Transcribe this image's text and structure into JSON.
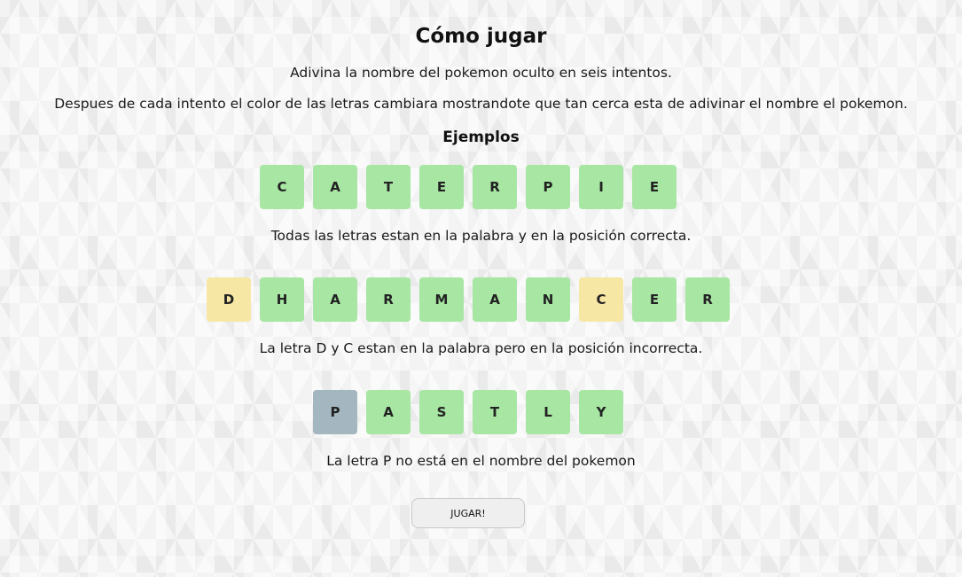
{
  "title": "Cómo jugar",
  "instructions": [
    "Adivina la nombre del pokemon oculto en seis intentos.",
    "Despues de cada intento el color de las letras cambiara mostrandote que tan cerca esta de adivinar el nombre el pokemon."
  ],
  "examples_heading": "Ejemplos",
  "colors": {
    "correct": "#a8e6a3",
    "present": "#f7e7a5",
    "absent": "#a4b6bf"
  },
  "examples": [
    {
      "tiles": [
        {
          "letter": "C",
          "state": "correct"
        },
        {
          "letter": "A",
          "state": "correct"
        },
        {
          "letter": "T",
          "state": "correct"
        },
        {
          "letter": "E",
          "state": "correct"
        },
        {
          "letter": "R",
          "state": "correct"
        },
        {
          "letter": "P",
          "state": "correct"
        },
        {
          "letter": "I",
          "state": "correct"
        },
        {
          "letter": "E",
          "state": "correct"
        }
      ],
      "caption": "Todas las letras estan en la palabra y en la posición correcta."
    },
    {
      "tiles": [
        {
          "letter": "D",
          "state": "present"
        },
        {
          "letter": "H",
          "state": "correct"
        },
        {
          "letter": "A",
          "state": "correct"
        },
        {
          "letter": "R",
          "state": "correct"
        },
        {
          "letter": "M",
          "state": "correct"
        },
        {
          "letter": "A",
          "state": "correct"
        },
        {
          "letter": "N",
          "state": "correct"
        },
        {
          "letter": "C",
          "state": "present"
        },
        {
          "letter": "E",
          "state": "correct"
        },
        {
          "letter": "R",
          "state": "correct"
        }
      ],
      "caption": "La letra D y C estan en la palabra pero en la posición incorrecta."
    },
    {
      "tiles": [
        {
          "letter": "P",
          "state": "absent"
        },
        {
          "letter": "A",
          "state": "correct"
        },
        {
          "letter": "S",
          "state": "correct"
        },
        {
          "letter": "T",
          "state": "correct"
        },
        {
          "letter": "L",
          "state": "correct"
        },
        {
          "letter": "Y",
          "state": "correct"
        }
      ],
      "caption": "La letra P no está en el nombre del pokemon"
    }
  ],
  "play_button_label": "JUGAR!"
}
